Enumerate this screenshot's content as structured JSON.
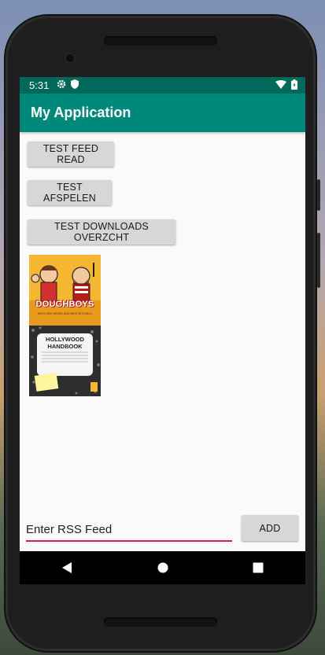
{
  "statusbar": {
    "time": "5:31",
    "icons": [
      "gear-icon",
      "shield-icon",
      "wifi-icon",
      "battery-icon"
    ]
  },
  "appbar": {
    "title": "My Application"
  },
  "buttons": {
    "test_feed_read": "TEST FEED READ",
    "test_afspelen": "TEST AFSPELEN",
    "test_downloads": "TEST DOWNLOADS OVERZCHT",
    "add": "ADD"
  },
  "podcasts": [
    {
      "title": "DOUGHBOYS",
      "subtitle": "WITH NICK WIGER AND MIKE MITCHELL"
    },
    {
      "title": "HOLLYWOOD HANDBOOK",
      "note": ""
    }
  ],
  "rss_input": {
    "value": "Enter RSS Feed",
    "placeholder": "Enter RSS Feed"
  },
  "colors": {
    "statusbar": "#00695c",
    "appbar": "#00897b",
    "accent": "#d81b60",
    "button": "#d6d7d7"
  },
  "navbar": {
    "icons": [
      "back-icon",
      "home-icon",
      "recents-icon"
    ]
  }
}
